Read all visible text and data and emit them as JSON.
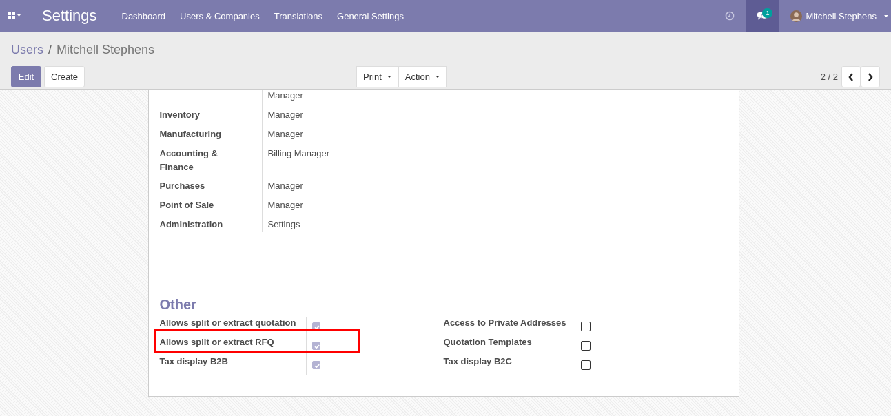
{
  "navbar": {
    "app_title": "Settings",
    "menu": [
      "Dashboard",
      "Users & Companies",
      "Translations",
      "General Settings"
    ],
    "messages_badge": "1",
    "user_name": "Mitchell Stephens"
  },
  "breadcrumb": {
    "parent": "Users",
    "separator": "/",
    "current": "Mitchell Stephens"
  },
  "buttons": {
    "edit": "Edit",
    "create": "Create",
    "print": "Print",
    "action": "Action"
  },
  "pager": "2 / 2",
  "access_rights": [
    {
      "value": "Manager"
    },
    {
      "label": "Inventory",
      "value": "Manager"
    },
    {
      "label": "Manufacturing",
      "value": "Manager"
    },
    {
      "label": "Accounting & Finance",
      "value": "Billing Manager"
    },
    {
      "label": "Purchases",
      "value": "Manager"
    },
    {
      "label": "Point of Sale",
      "value": "Manager"
    },
    {
      "label": "Administration",
      "value": "Settings"
    }
  ],
  "other": {
    "title": "Other",
    "left": [
      {
        "label": "Allows split or extract quotation",
        "checked": true,
        "highlighted": false
      },
      {
        "label": "Allows split or extract RFQ",
        "checked": true,
        "highlighted": true
      },
      {
        "label": "Tax display B2B",
        "checked": true,
        "highlighted": false
      }
    ],
    "right": [
      {
        "label": "Access to Private Addresses",
        "checked": false,
        "highlighted": false
      },
      {
        "label": "Quotation Templates",
        "checked": false,
        "highlighted": false
      },
      {
        "label": "Tax display B2C",
        "checked": false,
        "highlighted": false
      }
    ]
  }
}
